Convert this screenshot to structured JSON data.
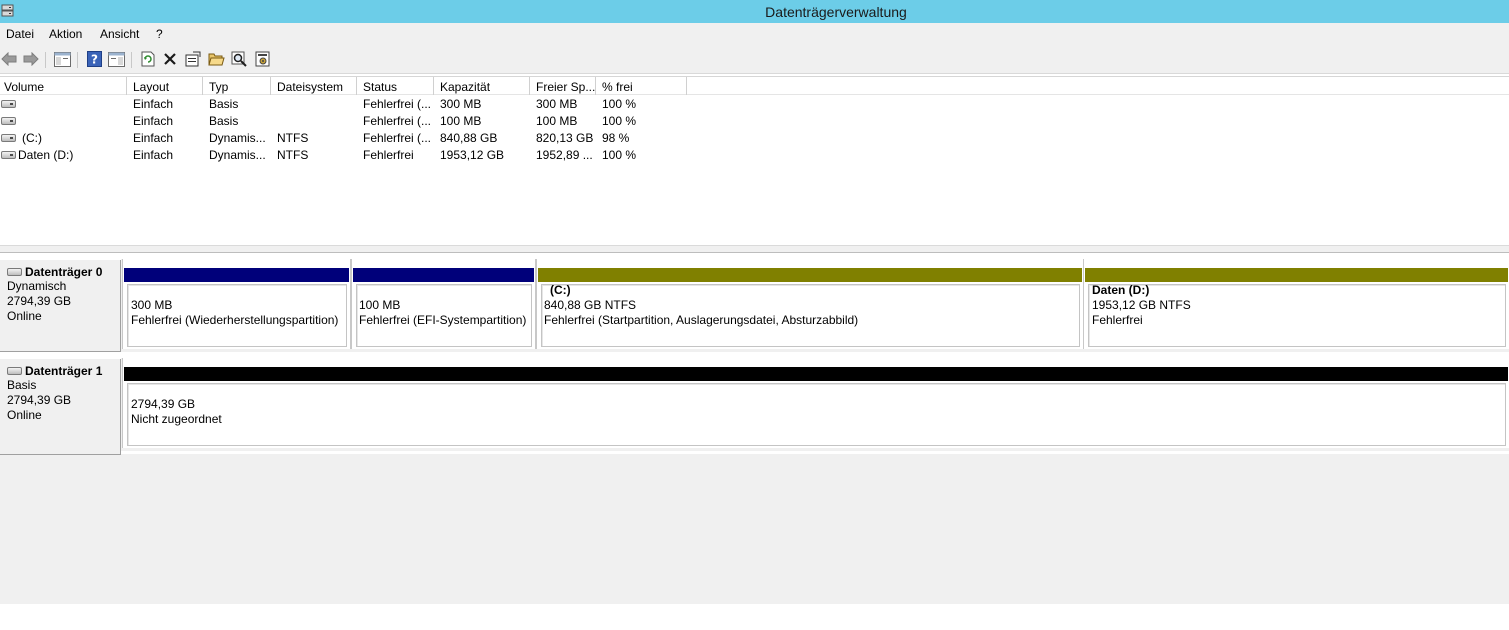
{
  "window": {
    "title": "Datenträgerverwaltung",
    "icon": "disk-management-icon"
  },
  "menu": [
    {
      "label": "Datei"
    },
    {
      "label": "Aktion"
    },
    {
      "label": "Ansicht"
    },
    {
      "label": "?"
    }
  ],
  "toolbar": {
    "icons": [
      "back-arrow-icon",
      "forward-arrow-icon",
      "show-hide-console-tree-icon",
      "help-icon",
      "show-hide-action-pane-icon",
      "refresh-icon",
      "delete-icon",
      "properties-icon",
      "open-folder-icon",
      "search-icon",
      "settings-icon"
    ]
  },
  "volumes": {
    "columns": [
      "Volume",
      "Layout",
      "Typ",
      "Dateisystem",
      "Status",
      "Kapazität",
      "Freier Sp...",
      "% frei"
    ],
    "rows": [
      {
        "volume": "",
        "layout": "Einfach",
        "typ": "Basis",
        "fs": "",
        "status": "Fehlerfrei (...",
        "kapazitat": "300 MB",
        "frei": "300 MB",
        "pct": "100 %"
      },
      {
        "volume": "",
        "layout": "Einfach",
        "typ": "Basis",
        "fs": "",
        "status": "Fehlerfrei (...",
        "kapazitat": "100 MB",
        "frei": "100 MB",
        "pct": "100 %"
      },
      {
        "volume": "(C:)",
        "layout": "Einfach",
        "typ": "Dynamis...",
        "fs": "NTFS",
        "status": "Fehlerfrei (...",
        "kapazitat": "840,88 GB",
        "frei": "820,13 GB",
        "pct": "98 %"
      },
      {
        "volume": "Daten (D:)",
        "layout": "Einfach",
        "typ": "Dynamis...",
        "fs": "NTFS",
        "status": "Fehlerfrei",
        "kapazitat": "1953,12 GB",
        "frei": "1952,89 ...",
        "pct": "100 %"
      }
    ]
  },
  "disks": [
    {
      "name": "Datenträger 0",
      "type": "Dynamisch",
      "size": "2794,39 GB",
      "state": "Online",
      "partitions": [
        {
          "title": "",
          "size": "300 MB",
          "status": "Fehlerfrei (Wiederherstellungspartition)",
          "bar_color": "#00007a"
        },
        {
          "title": "",
          "size": "100 MB",
          "status": "Fehlerfrei (EFI-Systempartition)",
          "bar_color": "#00007a"
        },
        {
          "title": "(C:)",
          "size": "840,88 GB NTFS",
          "status": "Fehlerfrei (Startpartition, Auslagerungsdatei, Absturzabbild)",
          "bar_color": "#808000"
        },
        {
          "title": "Daten  (D:)",
          "size": "1953,12 GB NTFS",
          "status": "Fehlerfrei",
          "bar_color": "#808000"
        }
      ]
    },
    {
      "name": "Datenträger 1",
      "type": "Basis",
      "size": "2794,39 GB",
      "state": "Online",
      "partitions": [
        {
          "title": "",
          "size": "2794,39 GB",
          "status": "Nicht zugeordnet",
          "bar_color": "#000000"
        }
      ]
    }
  ]
}
